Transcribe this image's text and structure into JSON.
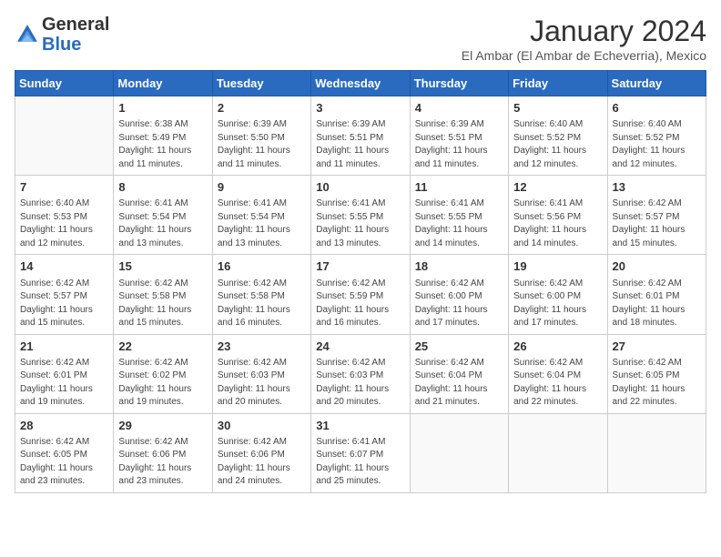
{
  "header": {
    "logo": {
      "general": "General",
      "blue": "Blue"
    },
    "month_title": "January 2024",
    "subtitle": "El Ambar (El Ambar de Echeverria), Mexico"
  },
  "days_of_week": [
    "Sunday",
    "Monday",
    "Tuesday",
    "Wednesday",
    "Thursday",
    "Friday",
    "Saturday"
  ],
  "weeks": [
    [
      {
        "day": "",
        "sunrise": "",
        "sunset": "",
        "daylight": ""
      },
      {
        "day": "1",
        "sunrise": "Sunrise: 6:38 AM",
        "sunset": "Sunset: 5:49 PM",
        "daylight": "Daylight: 11 hours and 11 minutes."
      },
      {
        "day": "2",
        "sunrise": "Sunrise: 6:39 AM",
        "sunset": "Sunset: 5:50 PM",
        "daylight": "Daylight: 11 hours and 11 minutes."
      },
      {
        "day": "3",
        "sunrise": "Sunrise: 6:39 AM",
        "sunset": "Sunset: 5:51 PM",
        "daylight": "Daylight: 11 hours and 11 minutes."
      },
      {
        "day": "4",
        "sunrise": "Sunrise: 6:39 AM",
        "sunset": "Sunset: 5:51 PM",
        "daylight": "Daylight: 11 hours and 11 minutes."
      },
      {
        "day": "5",
        "sunrise": "Sunrise: 6:40 AM",
        "sunset": "Sunset: 5:52 PM",
        "daylight": "Daylight: 11 hours and 12 minutes."
      },
      {
        "day": "6",
        "sunrise": "Sunrise: 6:40 AM",
        "sunset": "Sunset: 5:52 PM",
        "daylight": "Daylight: 11 hours and 12 minutes."
      }
    ],
    [
      {
        "day": "7",
        "sunrise": "Sunrise: 6:40 AM",
        "sunset": "Sunset: 5:53 PM",
        "daylight": "Daylight: 11 hours and 12 minutes."
      },
      {
        "day": "8",
        "sunrise": "Sunrise: 6:41 AM",
        "sunset": "Sunset: 5:54 PM",
        "daylight": "Daylight: 11 hours and 13 minutes."
      },
      {
        "day": "9",
        "sunrise": "Sunrise: 6:41 AM",
        "sunset": "Sunset: 5:54 PM",
        "daylight": "Daylight: 11 hours and 13 minutes."
      },
      {
        "day": "10",
        "sunrise": "Sunrise: 6:41 AM",
        "sunset": "Sunset: 5:55 PM",
        "daylight": "Daylight: 11 hours and 13 minutes."
      },
      {
        "day": "11",
        "sunrise": "Sunrise: 6:41 AM",
        "sunset": "Sunset: 5:55 PM",
        "daylight": "Daylight: 11 hours and 14 minutes."
      },
      {
        "day": "12",
        "sunrise": "Sunrise: 6:41 AM",
        "sunset": "Sunset: 5:56 PM",
        "daylight": "Daylight: 11 hours and 14 minutes."
      },
      {
        "day": "13",
        "sunrise": "Sunrise: 6:42 AM",
        "sunset": "Sunset: 5:57 PM",
        "daylight": "Daylight: 11 hours and 15 minutes."
      }
    ],
    [
      {
        "day": "14",
        "sunrise": "Sunrise: 6:42 AM",
        "sunset": "Sunset: 5:57 PM",
        "daylight": "Daylight: 11 hours and 15 minutes."
      },
      {
        "day": "15",
        "sunrise": "Sunrise: 6:42 AM",
        "sunset": "Sunset: 5:58 PM",
        "daylight": "Daylight: 11 hours and 15 minutes."
      },
      {
        "day": "16",
        "sunrise": "Sunrise: 6:42 AM",
        "sunset": "Sunset: 5:58 PM",
        "daylight": "Daylight: 11 hours and 16 minutes."
      },
      {
        "day": "17",
        "sunrise": "Sunrise: 6:42 AM",
        "sunset": "Sunset: 5:59 PM",
        "daylight": "Daylight: 11 hours and 16 minutes."
      },
      {
        "day": "18",
        "sunrise": "Sunrise: 6:42 AM",
        "sunset": "Sunset: 6:00 PM",
        "daylight": "Daylight: 11 hours and 17 minutes."
      },
      {
        "day": "19",
        "sunrise": "Sunrise: 6:42 AM",
        "sunset": "Sunset: 6:00 PM",
        "daylight": "Daylight: 11 hours and 17 minutes."
      },
      {
        "day": "20",
        "sunrise": "Sunrise: 6:42 AM",
        "sunset": "Sunset: 6:01 PM",
        "daylight": "Daylight: 11 hours and 18 minutes."
      }
    ],
    [
      {
        "day": "21",
        "sunrise": "Sunrise: 6:42 AM",
        "sunset": "Sunset: 6:01 PM",
        "daylight": "Daylight: 11 hours and 19 minutes."
      },
      {
        "day": "22",
        "sunrise": "Sunrise: 6:42 AM",
        "sunset": "Sunset: 6:02 PM",
        "daylight": "Daylight: 11 hours and 19 minutes."
      },
      {
        "day": "23",
        "sunrise": "Sunrise: 6:42 AM",
        "sunset": "Sunset: 6:03 PM",
        "daylight": "Daylight: 11 hours and 20 minutes."
      },
      {
        "day": "24",
        "sunrise": "Sunrise: 6:42 AM",
        "sunset": "Sunset: 6:03 PM",
        "daylight": "Daylight: 11 hours and 20 minutes."
      },
      {
        "day": "25",
        "sunrise": "Sunrise: 6:42 AM",
        "sunset": "Sunset: 6:04 PM",
        "daylight": "Daylight: 11 hours and 21 minutes."
      },
      {
        "day": "26",
        "sunrise": "Sunrise: 6:42 AM",
        "sunset": "Sunset: 6:04 PM",
        "daylight": "Daylight: 11 hours and 22 minutes."
      },
      {
        "day": "27",
        "sunrise": "Sunrise: 6:42 AM",
        "sunset": "Sunset: 6:05 PM",
        "daylight": "Daylight: 11 hours and 22 minutes."
      }
    ],
    [
      {
        "day": "28",
        "sunrise": "Sunrise: 6:42 AM",
        "sunset": "Sunset: 6:05 PM",
        "daylight": "Daylight: 11 hours and 23 minutes."
      },
      {
        "day": "29",
        "sunrise": "Sunrise: 6:42 AM",
        "sunset": "Sunset: 6:06 PM",
        "daylight": "Daylight: 11 hours and 23 minutes."
      },
      {
        "day": "30",
        "sunrise": "Sunrise: 6:42 AM",
        "sunset": "Sunset: 6:06 PM",
        "daylight": "Daylight: 11 hours and 24 minutes."
      },
      {
        "day": "31",
        "sunrise": "Sunrise: 6:41 AM",
        "sunset": "Sunset: 6:07 PM",
        "daylight": "Daylight: 11 hours and 25 minutes."
      },
      {
        "day": "",
        "sunrise": "",
        "sunset": "",
        "daylight": ""
      },
      {
        "day": "",
        "sunrise": "",
        "sunset": "",
        "daylight": ""
      },
      {
        "day": "",
        "sunrise": "",
        "sunset": "",
        "daylight": ""
      }
    ]
  ]
}
